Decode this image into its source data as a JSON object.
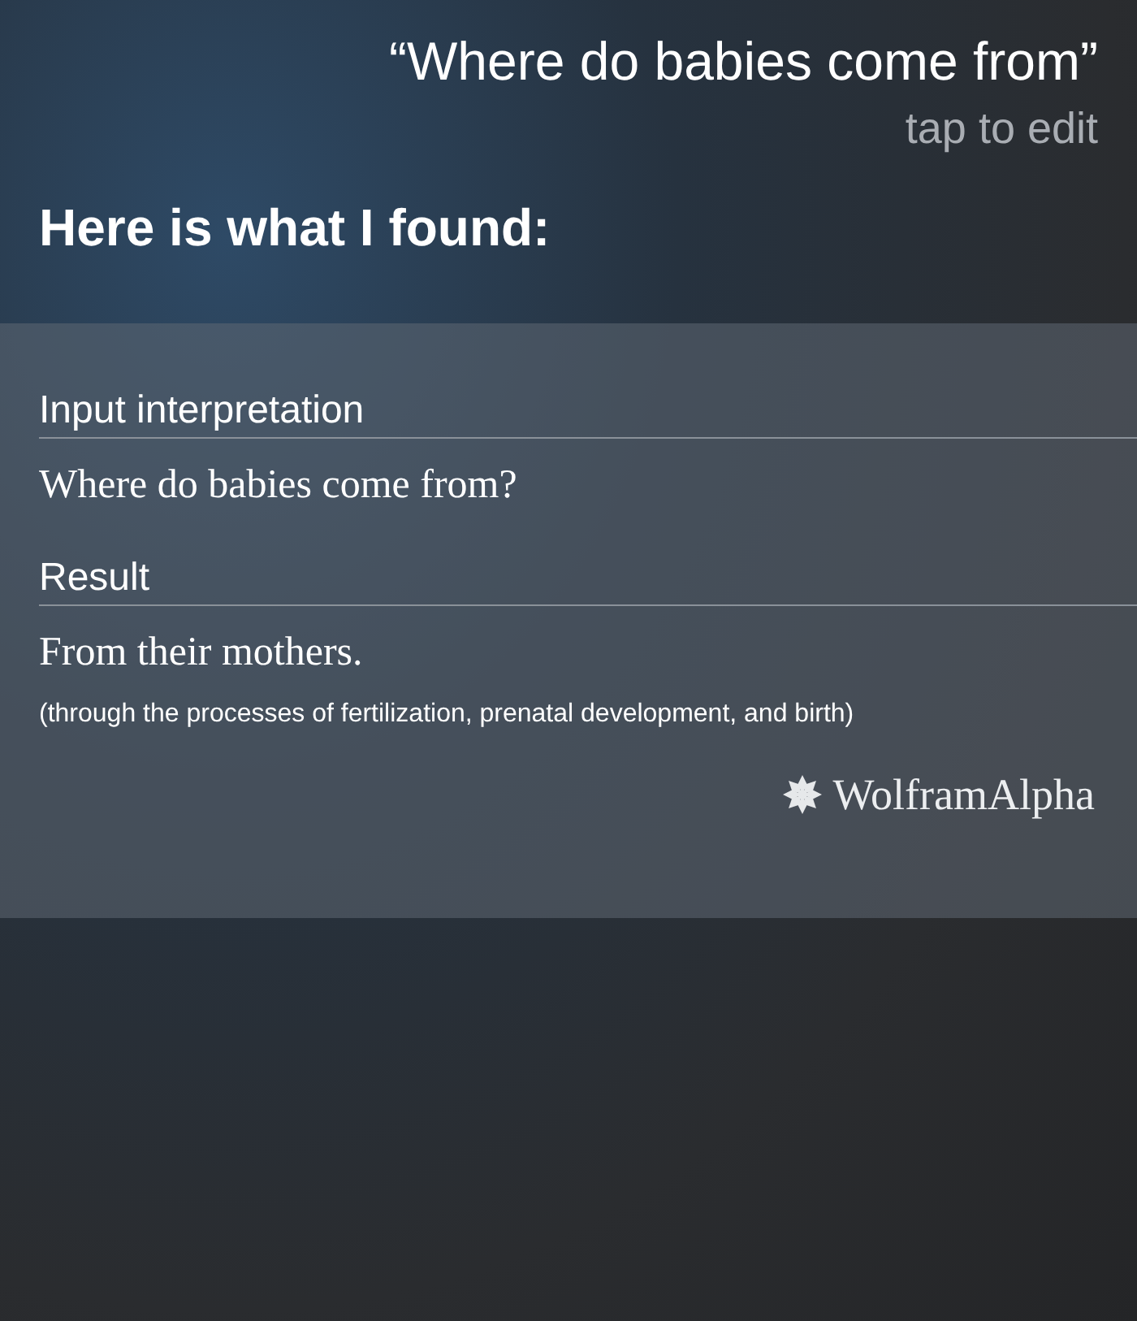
{
  "query": {
    "text": "“Where do babies come from”",
    "hint": "tap to edit"
  },
  "heading": "Here is what I found:",
  "card": {
    "pods": [
      {
        "title": "Input interpretation",
        "lines": [
          {
            "kind": "primary",
            "text": "Where do babies come from?"
          }
        ]
      },
      {
        "title": "Result",
        "lines": [
          {
            "kind": "primary",
            "text": "From their mothers."
          },
          {
            "kind": "note",
            "text": "(through the processes of fertilization, prenatal development, and birth)"
          }
        ]
      }
    ],
    "source": "WolframAlpha"
  }
}
